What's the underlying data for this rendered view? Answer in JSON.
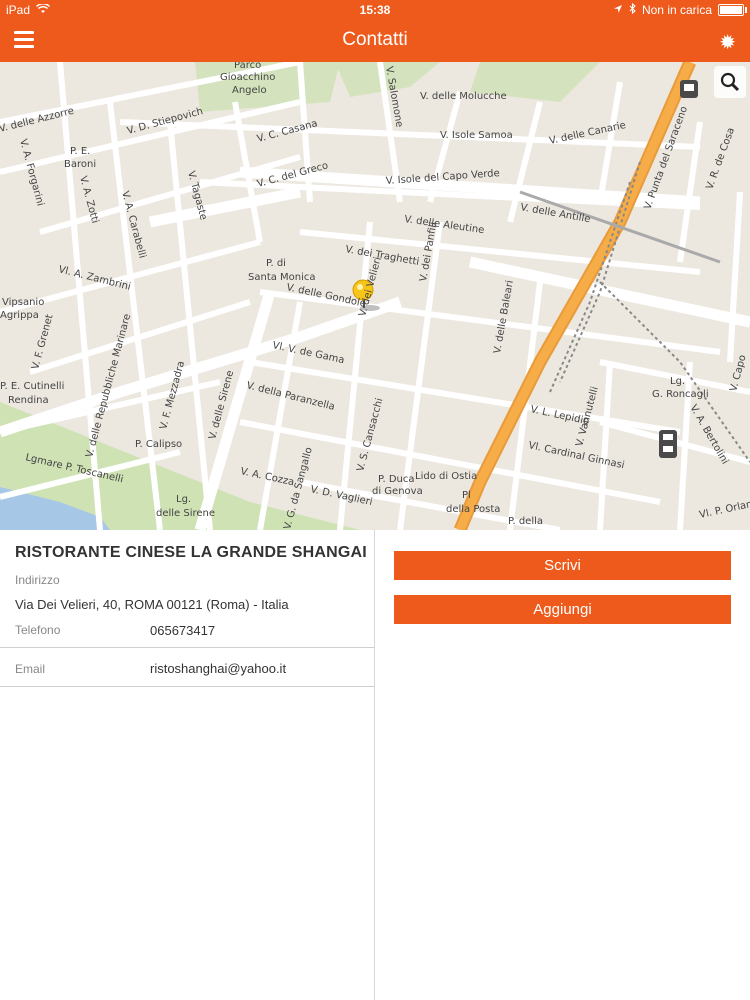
{
  "status": {
    "device": "iPad",
    "time": "15:38",
    "charging": "Non in carica",
    "battery_level": 0.9
  },
  "navbar": {
    "title": "Contatti"
  },
  "map": {
    "labels": {
      "parco": "Parco",
      "gioacchino": "Gioacchino",
      "angelo": "Angelo",
      "salomone": "V. Salomone",
      "molucche": "V. delle Molucche",
      "azzorre": "V. delle Azzorre",
      "stiepovich": "V. D. Stiepovich",
      "casana": "V. C. Casana",
      "isole_samoa": "V. Isole Samoa",
      "canarie": "V. delle Canarie",
      "saraceno": "V. Punta del Saraceno",
      "capo_cosa": "V. R. de Cosa",
      "pe": "P. E.",
      "baroni": "Baroni",
      "forgarini": "V. A. Forgarini",
      "zotti": "V. A. Zotti",
      "carabelli": "V. A. Carabelli",
      "tagaste": "V. Tagaste",
      "greco": "V. C. del Greco",
      "capo_verde": "V. Isole del Capo Verde",
      "aleutine": "V. delle Aleutine",
      "antille": "V. delle Antille",
      "zambrini": "Vl. A. Zambrini",
      "p_di": "P. di",
      "santa_monica": "Santa Monica",
      "traghetti": "V. dei Traghetti",
      "velieri": "V. dei Velieri",
      "panfili": "V. dei Panfili",
      "gondole": "V. delle Gondole",
      "baleari": "V. delle Baleari",
      "vipsanio": "Vipsanio",
      "agrippa": "Agrippa",
      "grenet": "V. F. Grenet",
      "marinare": "V. delle Repubbliche Marinare",
      "vasco_gama": "Vl. V. de Gama",
      "pe2": "P. E. Cutinelli",
      "rendina": "Rendina",
      "mezzadra": "V. F. Mezzadra",
      "sirene": "V. delle Sirene",
      "paranzella": "V. della Paranzella",
      "casaccio": "V. S. Cansacchi",
      "lepidio": "V. L. Lepidio",
      "vannutelli": "V. Vannutelli",
      "roncagli": "Lg.",
      "roncagli2": "G. Roncagli",
      "bertolini": "V. A. Bertolini",
      "calipso": "P. Calipso",
      "toscanelli": "Lgmare P. Toscanelli",
      "cardinal": "Vl. Cardinal Ginnasi",
      "cozza": "V. A. Cozza",
      "sangallo": "V. G. da Sangallo",
      "vaglieri": "V. D. Vaglieri",
      "lg_sirene": "Lg.",
      "lg_sirene2": "delle Sirene",
      "duca": "P. Duca",
      "genova": "di Genova",
      "lido": "Lido di Ostia",
      "pl": "Pl",
      "posta": "della Posta",
      "pdella": "P. della",
      "orlando": "Vl. P. Orlan",
      "capo": "V. Capo"
    }
  },
  "contact": {
    "name": "RISTORANTE CINESE LA GRANDE SHANGAI",
    "address_label": "Indirizzo",
    "address": "Via Dei Velieri, 40, ROMA 00121 (Roma) - Italia",
    "phone_label": "Telefono",
    "phone": "065673417",
    "email_label": "Email",
    "email": "ristoshanghai@yahoo.it"
  },
  "actions": {
    "write": "Scrivi",
    "add": "Aggiungi"
  },
  "colors": {
    "accent": "#ee5a1c",
    "map_bg": "#ece8e0",
    "road": "#ffffff",
    "highway": "#f2a03f",
    "park": "#cfe2b4",
    "water": "#a7c7e6"
  }
}
